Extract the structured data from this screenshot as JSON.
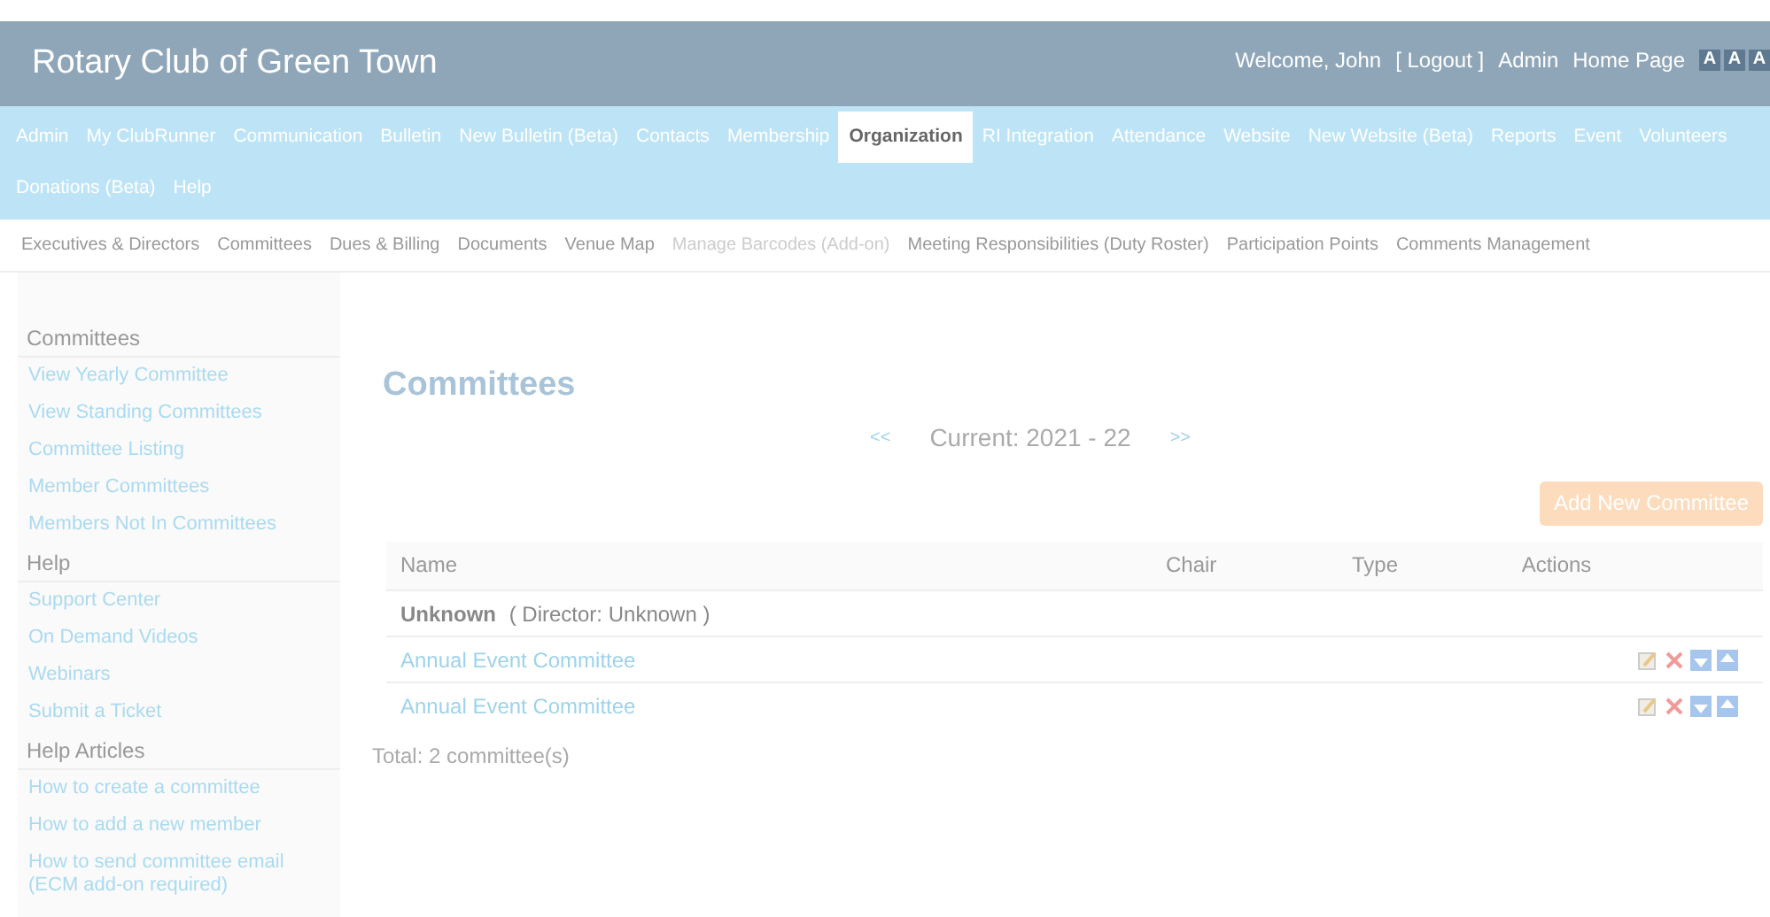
{
  "header": {
    "title": "Rotary Club of Green Town",
    "welcome": "Welcome, John",
    "logout": "[ Logout ]",
    "links": [
      "Admin",
      "Home Page"
    ],
    "font_size_buttons": [
      "A",
      "A",
      "A"
    ]
  },
  "nav": [
    {
      "label": "Admin",
      "selected": false
    },
    {
      "label": "My ClubRunner",
      "selected": false
    },
    {
      "label": "Communication",
      "selected": false
    },
    {
      "label": "Bulletin",
      "selected": false
    },
    {
      "label": "New Bulletin (Beta)",
      "selected": false
    },
    {
      "label": "Contacts",
      "selected": false
    },
    {
      "label": "Membership",
      "selected": false
    },
    {
      "label": "Organization",
      "selected": true
    },
    {
      "label": "RI Integration",
      "selected": false
    },
    {
      "label": "Attendance",
      "selected": false
    },
    {
      "label": "Website",
      "selected": false
    },
    {
      "label": "New Website (Beta)",
      "selected": false
    },
    {
      "label": "Reports",
      "selected": false
    },
    {
      "label": "Event",
      "selected": false
    },
    {
      "label": "Volunteers",
      "selected": false
    },
    {
      "label": "Donations (Beta)",
      "selected": false
    },
    {
      "label": "Help",
      "selected": false
    }
  ],
  "subnav": [
    {
      "label": "Executives & Directors",
      "disabled": false
    },
    {
      "label": "Committees",
      "disabled": false
    },
    {
      "label": "Dues & Billing",
      "disabled": false
    },
    {
      "label": "Documents",
      "disabled": false
    },
    {
      "label": "Venue Map",
      "disabled": false
    },
    {
      "label": "Manage Barcodes (Add-on)",
      "disabled": true
    },
    {
      "label": "Meeting Responsibilities (Duty Roster)",
      "disabled": false
    },
    {
      "label": "Participation Points",
      "disabled": false
    },
    {
      "label": "Comments Management",
      "disabled": false
    }
  ],
  "sidebar": [
    {
      "heading": "Committees",
      "items": [
        "View Yearly Committee",
        "View Standing Committees",
        "Committee Listing",
        "Member Committees",
        "Members Not In Committees"
      ]
    },
    {
      "heading": "Help",
      "items": [
        "Support Center",
        "On Demand Videos",
        "Webinars",
        "Submit a Ticket"
      ]
    },
    {
      "heading": "Help Articles",
      "items": [
        "How to create a committee",
        "How to add a new member",
        "How to send committee email (ECM add-on required)"
      ]
    }
  ],
  "main": {
    "title": "Committees",
    "prev": "<<",
    "current": "Current: 2021 - 22",
    "next": ">>",
    "add_button": "Add New Committee",
    "table": {
      "columns": [
        "Name",
        "Chair",
        "Type",
        "Actions"
      ],
      "group": {
        "name": "Unknown",
        "director": "( Director: Unknown )"
      },
      "rows": [
        {
          "name": "Annual Event Committee"
        },
        {
          "name": "Annual Event Committee"
        }
      ]
    },
    "total": "Total: 2 committee(s)"
  }
}
